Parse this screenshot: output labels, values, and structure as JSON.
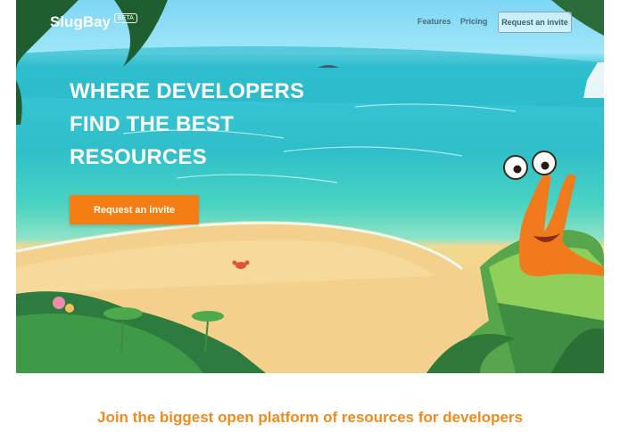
{
  "nav": {
    "logo": "SlugBay",
    "badge": "BETA",
    "links": [
      "Features",
      "Pricing"
    ],
    "cta": "Request an invite"
  },
  "hero": {
    "headline_lines": [
      "WHERE DEVELOPERS",
      "FIND THE BEST",
      "RESOURCES"
    ],
    "cta": "Request an invite"
  },
  "tagline": "Join the biggest open platform of resources for developers",
  "colors": {
    "accent": "#f57e14",
    "tagline": "#f08a1c",
    "sea": "#2fbfca",
    "sand": "#f4cf86"
  }
}
